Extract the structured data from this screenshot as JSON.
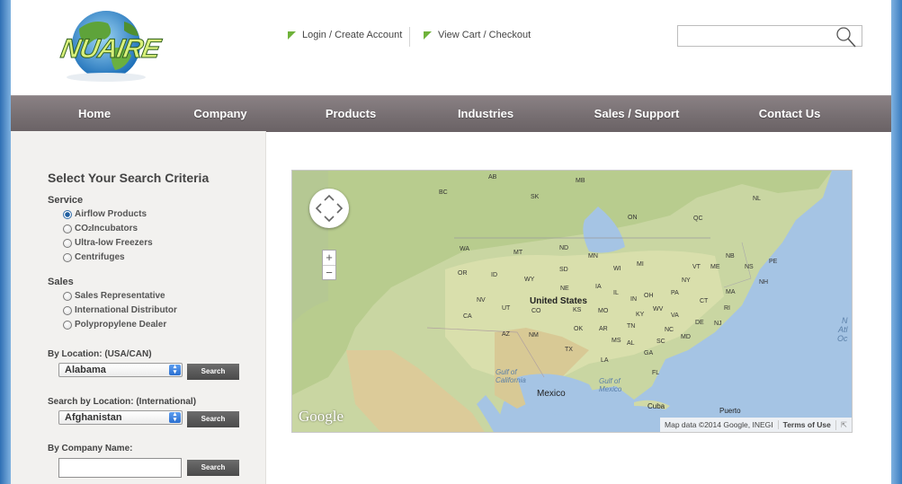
{
  "brand": {
    "logo_text": "NUAIRE"
  },
  "header": {
    "login_label": "Login / Create Account",
    "cart_label": "View Cart / Checkout",
    "search_value": "",
    "icons": {
      "search": "magnifier-icon",
      "link_marker": "green-flag-icon"
    }
  },
  "nav": {
    "items": [
      {
        "label": "Home"
      },
      {
        "label": "Company"
      },
      {
        "label": "Products"
      },
      {
        "label": "Industries"
      },
      {
        "label": "Sales / Support"
      },
      {
        "label": "Contact Us"
      }
    ]
  },
  "sidebar": {
    "title": "Select Your Search Criteria",
    "service": {
      "heading": "Service",
      "options": [
        {
          "label": "Airflow Products",
          "selected": true
        },
        {
          "label_pre": "CO",
          "label_sub": "2",
          "label_post": "Incubators",
          "selected": false
        },
        {
          "label": "Ultra-low Freezers",
          "selected": false
        },
        {
          "label": "Centrifuges",
          "selected": false
        }
      ]
    },
    "sales": {
      "heading": "Sales",
      "options": [
        {
          "label": "Sales Representative",
          "selected": false
        },
        {
          "label": "International Distributor",
          "selected": false
        },
        {
          "label": "Polypropylene Dealer",
          "selected": false
        }
      ]
    },
    "location_us": {
      "label": "By Location: (USA/CAN)",
      "selected": "Alabama",
      "button": "Search"
    },
    "location_intl": {
      "label": "Search by Location: (International)",
      "selected": "Afghanistan",
      "button": "Search"
    },
    "company": {
      "label": "By Company Name:",
      "value": "",
      "button": "Search"
    }
  },
  "map": {
    "provider": "Google",
    "attribution": "Map data ©2014 Google, INEGI",
    "terms": "Terms of Use",
    "expand_glyph": "⇱",
    "zoom_in": "+",
    "zoom_out": "−",
    "pan_icon": "pan-control-icon",
    "labels": {
      "ab": "AB",
      "mb": "MB",
      "bc": "BC",
      "sk": "SK",
      "nl": "NL",
      "on": "ON",
      "qc": "QC",
      "wa": "WA",
      "mt": "MT",
      "nd": "ND",
      "mn": "MN",
      "or": "OR",
      "id": "ID",
      "wy": "WY",
      "sd": "SD",
      "wi": "WI",
      "mi": "MI",
      "ny": "NY",
      "vt": "VT",
      "me": "ME",
      "nb": "NB",
      "ns": "NS",
      "pe": "PE",
      "nh": "NH",
      "ma": "MA",
      "ct": "CT",
      "ri": "RI",
      "nv": "NV",
      "ut": "UT",
      "co": "CO",
      "ne": "NE",
      "ia": "IA",
      "il": "IL",
      "in": "IN",
      "oh": "OH",
      "pa": "PA",
      "nj": "NJ",
      "de": "DE",
      "md": "MD",
      "ca": "CA",
      "ks": "KS",
      "mo": "MO",
      "ky": "KY",
      "wv": "WV",
      "va": "VA",
      "az": "AZ",
      "nm": "NM",
      "ok": "OK",
      "ar": "AR",
      "tn": "TN",
      "nc": "NC",
      "tx": "TX",
      "ms": "MS",
      "al": "AL",
      "sc": "SC",
      "ga": "GA",
      "la": "LA",
      "fl": "FL",
      "us": "United States",
      "mexico": "Mexico",
      "cuba": "Cuba",
      "puerto": "Puerto",
      "gulf_ca": "Gulf of\nCalifornia",
      "gulf_mx": "Gulf of\nMexico",
      "atl": "N\nAtl\nOc"
    }
  }
}
